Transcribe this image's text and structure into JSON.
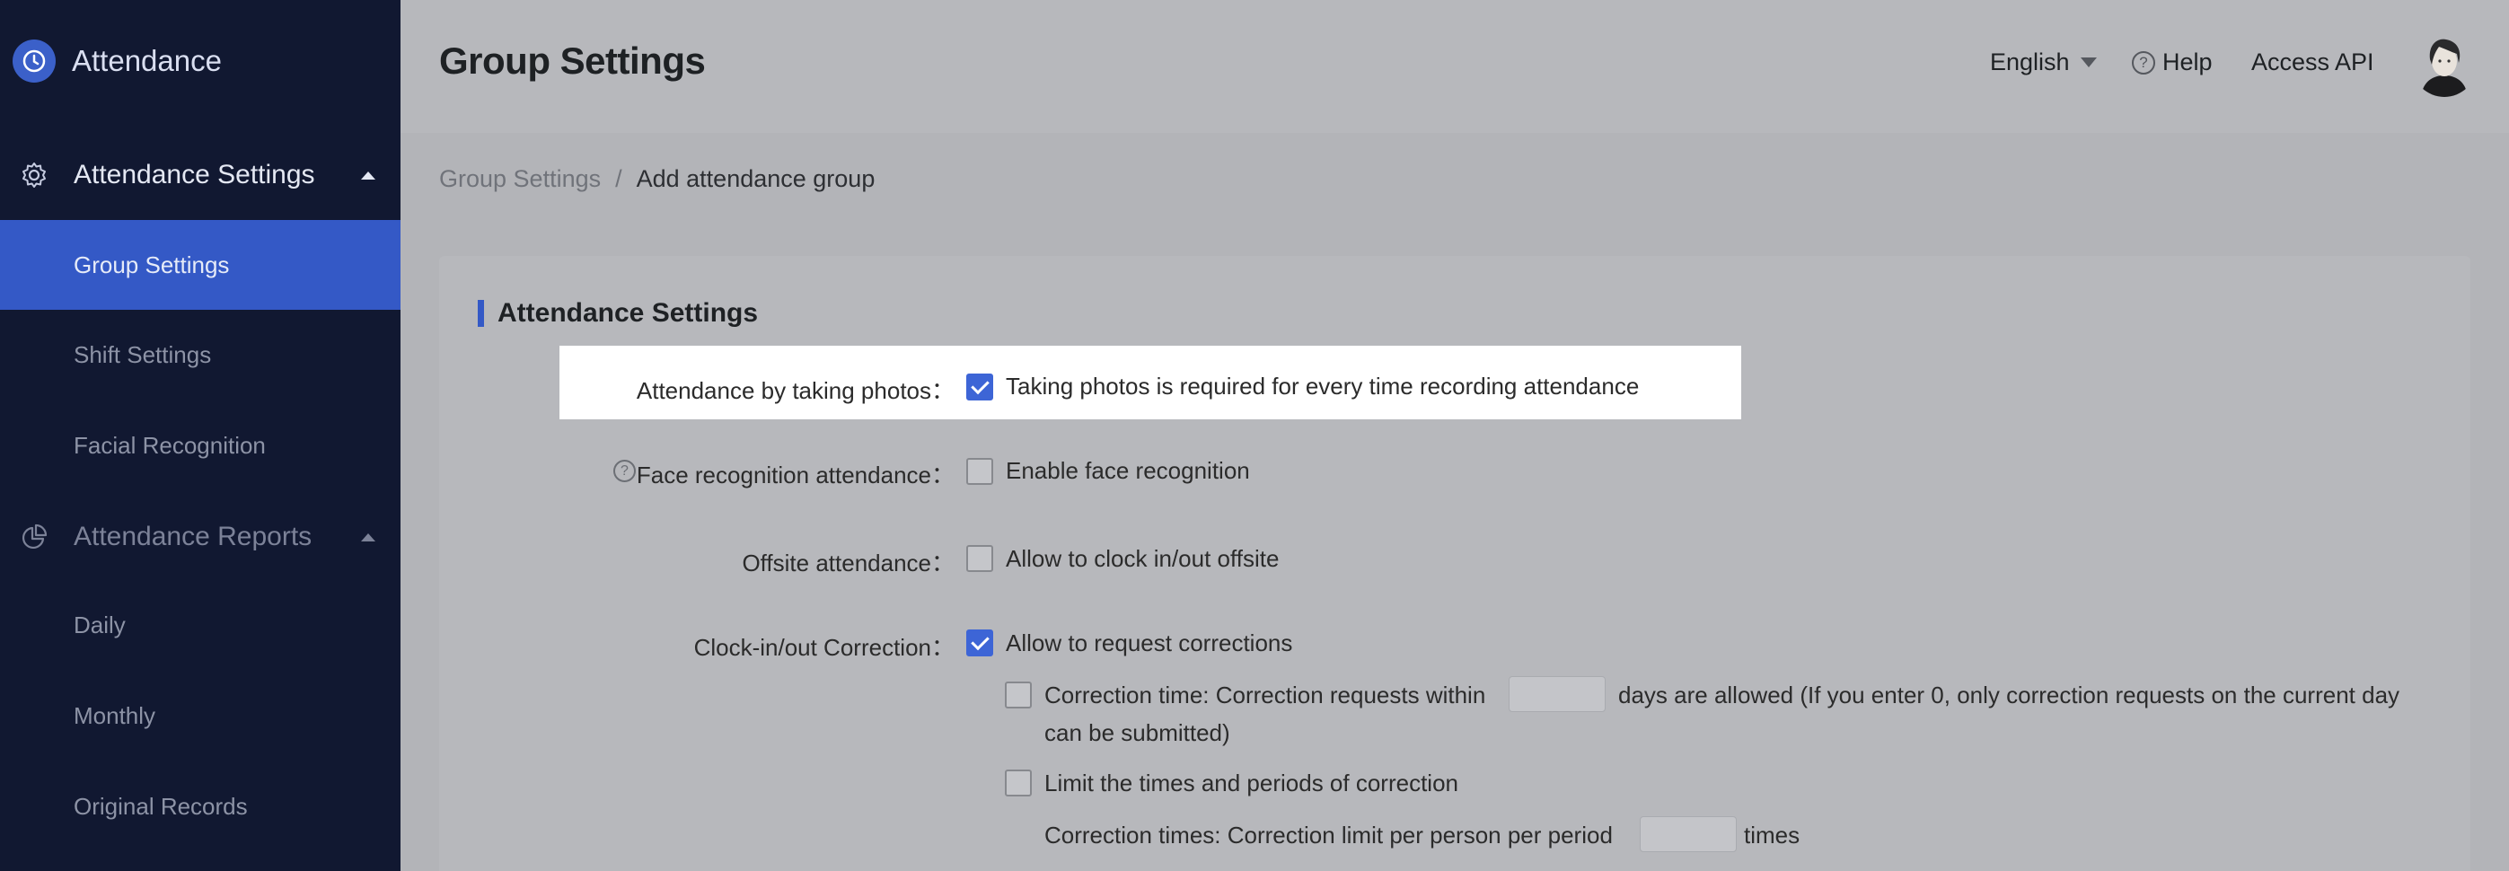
{
  "app": {
    "name": "Attendance",
    "accent": "#3459c6"
  },
  "sidebar": {
    "groups": [
      {
        "label": "Attendance Settings",
        "icon": "gear-icon",
        "items": [
          {
            "label": "Group Settings",
            "active": true
          },
          {
            "label": "Shift Settings",
            "active": false
          },
          {
            "label": "Facial Recognition",
            "active": false
          }
        ]
      },
      {
        "label": "Attendance Reports",
        "icon": "pie-chart-icon",
        "items": [
          {
            "label": "Daily",
            "active": false
          },
          {
            "label": "Monthly",
            "active": false
          },
          {
            "label": "Original Records",
            "active": false
          }
        ]
      }
    ]
  },
  "header": {
    "title": "Group Settings",
    "language": "English",
    "help": "Help",
    "access_api": "Access API"
  },
  "breadcrumb": {
    "root": "Group Settings",
    "separator": "/",
    "current": "Add attendance group"
  },
  "section": {
    "title": "Attendance Settings"
  },
  "form": {
    "photo": {
      "label": "Attendance by taking photos：",
      "option": "Taking photos is required for every time recording attendance",
      "checked": true
    },
    "face": {
      "label": "Face recognition attendance：",
      "option": "Enable face recognition",
      "checked": false
    },
    "offsite": {
      "label": "Offsite attendance：",
      "option": "Allow to clock in/out offsite",
      "checked": false
    },
    "correction": {
      "label": "Clock-in/out Correction：",
      "option": "Allow to request corrections",
      "checked": true
    },
    "correction_time": {
      "prefix": "Correction time: Correction requests within",
      "suffix": "days are allowed (If you enter 0, only correction requests on the current day",
      "line2": "can be submitted)",
      "value": "",
      "checked": false
    },
    "limit": {
      "option": "Limit the times and periods of correction",
      "checked": false
    },
    "correction_times": {
      "prefix": "Correction times: Correction limit per person per period",
      "suffix": "times",
      "value": ""
    }
  }
}
